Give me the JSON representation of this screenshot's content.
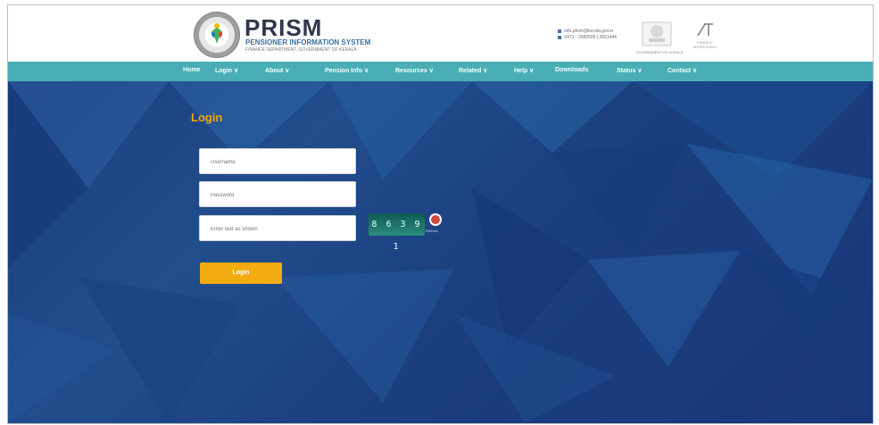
{
  "header": {
    "brand": "PRISM",
    "subtitle": "PENSIONER INFORMATION SYSTEM",
    "subsubtitle": "FINANCE DEPARTMENT, GOVERNMENT OF KERALA",
    "contact_email": "info.prism@kerala.gov.in",
    "contact_phone": "0471 - 2660505 | 2661444",
    "emblem_label": "GOVERNMENT OF KERALA",
    "dept_text": "FINANCE DEPARTMENT"
  },
  "nav": [
    "Home",
    "Login ∨",
    "About ∨",
    "Pension Info ∨",
    "Resources ∨",
    "Related ∨",
    "Help ∨",
    "Downloads",
    "Status ∨",
    "Contact ∨"
  ],
  "login": {
    "title": "Login",
    "username_placeholder": "Username",
    "password_placeholder": "Password",
    "captcha_placeholder": "Enter text as shown",
    "captcha_text": "8 6 3 9 1",
    "refresh_label": "Refresh",
    "button_label": "Login"
  },
  "colors": {
    "nav_bg": "#4aaeb7",
    "hero_bg": "#214d8d",
    "accent": "#f2ac12"
  }
}
